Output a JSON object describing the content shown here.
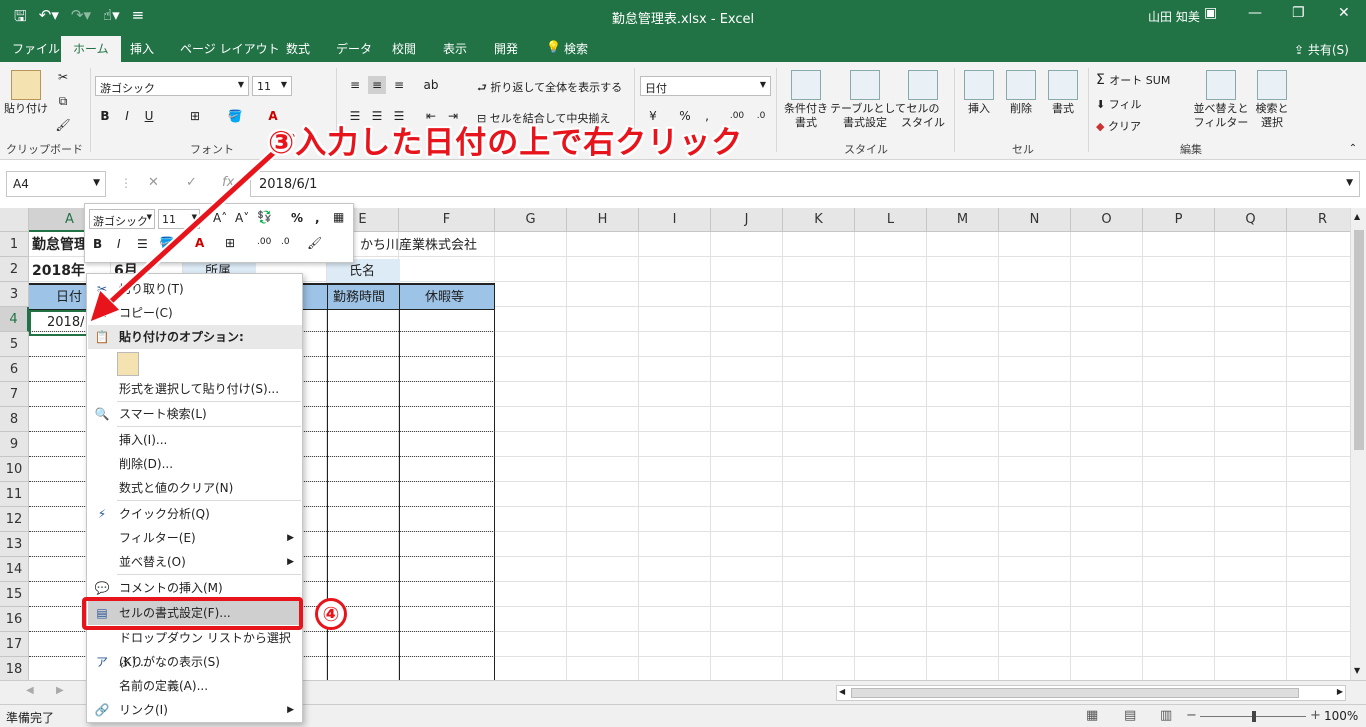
{
  "window": {
    "title": "勤怠管理表.xlsx - Excel",
    "user": "山田 知美"
  },
  "tabs": [
    "ファイル",
    "ホーム",
    "挿入",
    "ページ レイアウト",
    "数式",
    "データ",
    "校閲",
    "表示",
    "開発",
    "検索"
  ],
  "share_label": "共有(S)",
  "ribbon": {
    "clipboard_label": "クリップボード",
    "paste_label": "貼り付け",
    "font_label": "フォント",
    "font_name": "游ゴシック",
    "font_size": "11",
    "wrap_text": "折り返して全体を表示する",
    "merge_center": "セルを結合して中央揃え",
    "number_format": "日付",
    "cond_format": "条件付き\n書式",
    "format_table": "テーブルとして\n書式設定",
    "cell_styles": "セルの\nスタイル",
    "styles_label": "スタイル",
    "insert": "挿入",
    "delete": "削除",
    "format": "書式",
    "cells_label": "セル",
    "autosum": "オート SUM",
    "fill": "フィル",
    "clear": "クリア",
    "sort_filter": "並べ替えと\nフィルター",
    "find_select": "検索と\n選択",
    "editing_label": "編集"
  },
  "formula_bar": {
    "name_box": "A4",
    "formula": "2018/6/1"
  },
  "columns": [
    "A",
    "B",
    "C",
    "D",
    "E",
    "F",
    "G",
    "H",
    "I",
    "J",
    "K",
    "L",
    "M",
    "N",
    "O",
    "P",
    "Q",
    "R"
  ],
  "rows": [
    "1",
    "2",
    "3",
    "4",
    "5",
    "6",
    "7",
    "8",
    "9",
    "10",
    "11",
    "12",
    "13",
    "14",
    "15",
    "16",
    "17",
    "18"
  ],
  "cells": {
    "a1": "勤怠管理",
    "d1": "かち川産業株式会社",
    "a2": "2018年",
    "b2": "6月",
    "c2": "所属",
    "e2": "氏名",
    "a3": "日付",
    "e3": "勤務時間",
    "f3": "休暇等",
    "a4": "2018/"
  },
  "mini_toolbar": {
    "font_name": "游ゴシック",
    "font_size": "11"
  },
  "context_menu": [
    {
      "label": "切り取り(T)",
      "icon": "cut-icon"
    },
    {
      "label": "コピー(C)",
      "icon": "copy-icon"
    },
    {
      "label": "貼り付けのオプション:",
      "icon": "paste-icon"
    },
    {
      "label": "形式を選択して貼り付け(S)...",
      "icon": ""
    },
    {
      "label": "スマート検索(L)",
      "icon": "smart-lookup-icon"
    },
    {
      "label": "挿入(I)...",
      "icon": ""
    },
    {
      "label": "削除(D)...",
      "icon": ""
    },
    {
      "label": "数式と値のクリア(N)",
      "icon": ""
    },
    {
      "label": "クイック分析(Q)",
      "icon": "quick-analysis-icon"
    },
    {
      "label": "フィルター(E)",
      "icon": ""
    },
    {
      "label": "並べ替え(O)",
      "icon": ""
    },
    {
      "label": "コメントの挿入(M)",
      "icon": "comment-icon"
    },
    {
      "label": "セルの書式設定(F)...",
      "icon": "format-cells-icon"
    },
    {
      "label": "ドロップダウン リストから選択(K)...",
      "icon": ""
    },
    {
      "label": "ふりがなの表示(S)",
      "icon": "furigana-icon"
    },
    {
      "label": "名前の定義(A)...",
      "icon": ""
    },
    {
      "label": "リンク(I)",
      "icon": "link-icon"
    }
  ],
  "annotations": {
    "step3": "③入力した日付の上で右クリック",
    "step4": "④"
  },
  "status": {
    "ready": "準備完了",
    "zoom": "100%"
  },
  "colors": {
    "excel_green": "#217346",
    "header_fill": "#9dc3e6",
    "annotation_red": "#e8141c"
  }
}
